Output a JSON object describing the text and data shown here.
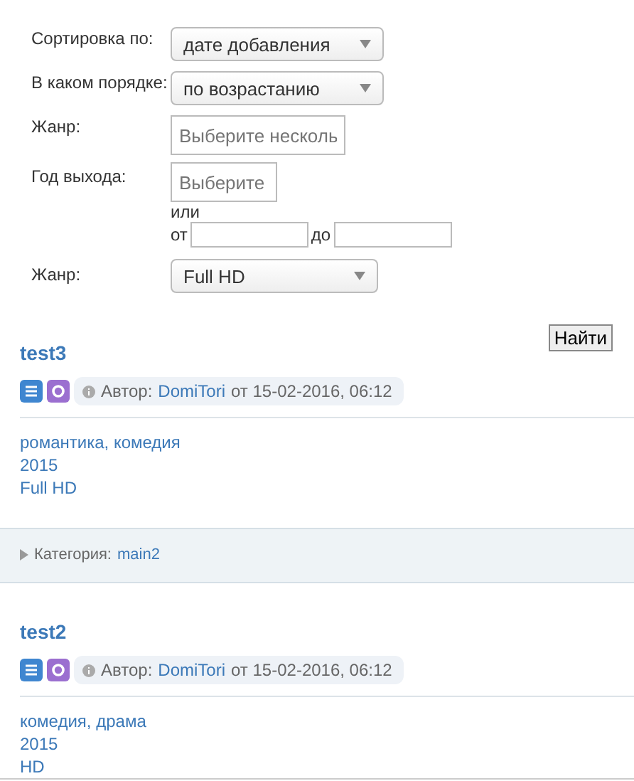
{
  "filters": [
    {
      "kind": "select",
      "label": "Сортировка по:",
      "value": "дате добавления"
    },
    {
      "kind": "select",
      "label": "В каком порядке:",
      "value": "по возрастанию"
    },
    {
      "kind": "multi",
      "label": "Жанр:",
      "placeholder": "Выберите несколь"
    },
    {
      "kind": "year",
      "label": "Год выхода:",
      "placeholder": "Выберите",
      "or": "или",
      "from": "от",
      "to": "до"
    },
    {
      "kind": "select",
      "label": "Жанр:",
      "value": "Full HD"
    }
  ],
  "search_button": "Найти",
  "posts": [
    {
      "title": "test3",
      "author_label": "Автор:",
      "author": "DomiTori",
      "date": "от 15-02-2016, 06:12",
      "genres": "романтика, комедия",
      "year": "2015",
      "quality": "Full HD",
      "category_label": "Категория:",
      "category": "main2"
    },
    {
      "title": "test2",
      "author_label": "Автор:",
      "author": "DomiTori",
      "date": "от 15-02-2016, 06:12",
      "genres": "комедия, драма",
      "year": "2015",
      "quality": "HD"
    }
  ]
}
